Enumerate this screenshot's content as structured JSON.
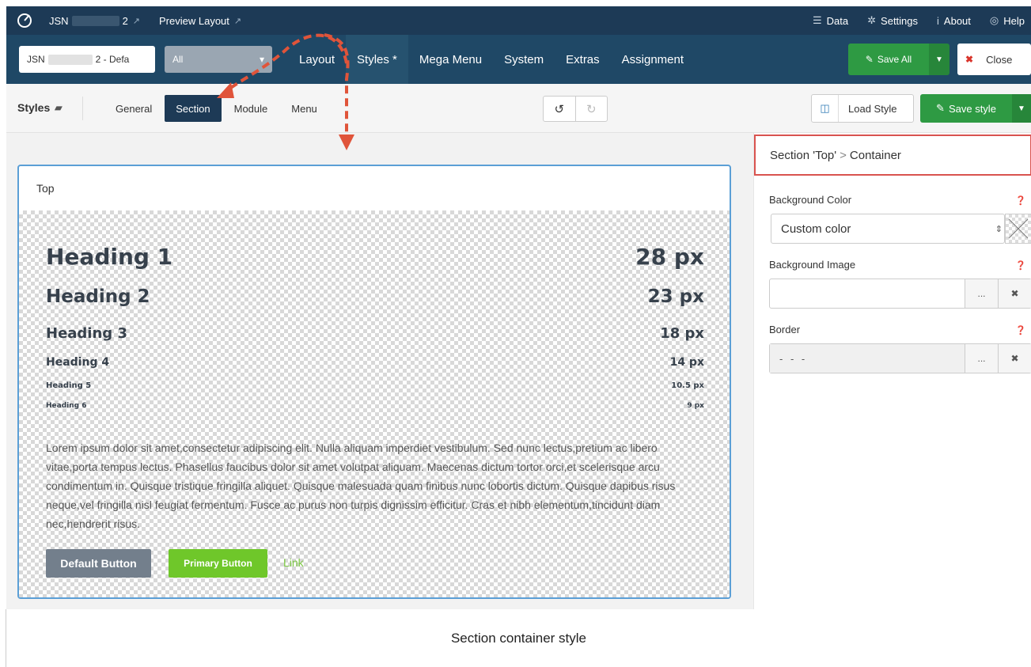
{
  "topbar": {
    "product_prefix": "JSN",
    "product_suffix": "2",
    "preview_layout": "Preview Layout",
    "data": "Data",
    "settings": "Settings",
    "about": "About",
    "help": "Help"
  },
  "navbar": {
    "layout_select_prefix": "JSN",
    "layout_select_suffix": "2 - Defa",
    "filter_select": "All",
    "tabs": [
      {
        "label": "Layout"
      },
      {
        "label": "Styles *"
      },
      {
        "label": "Mega Menu"
      },
      {
        "label": "System"
      },
      {
        "label": "Extras"
      },
      {
        "label": "Assignment"
      }
    ],
    "save_all": "Save All",
    "close": "Close"
  },
  "stylesbar": {
    "title": "Styles",
    "tabs": [
      {
        "label": "General"
      },
      {
        "label": "Section"
      },
      {
        "label": "Module"
      },
      {
        "label": "Menu"
      }
    ],
    "load_style": "Load Style",
    "save_style": "Save style"
  },
  "preview": {
    "section_name": "Top",
    "headings": [
      {
        "label": "Heading 1",
        "size": "28 px"
      },
      {
        "label": "Heading 2",
        "size": "23 px"
      },
      {
        "label": "Heading 3",
        "size": "18 px"
      },
      {
        "label": "Heading 4",
        "size": "14 px"
      },
      {
        "label": "Heading 5",
        "size": "10.5 px"
      },
      {
        "label": "Heading 6",
        "size": "9 px"
      }
    ],
    "paragraph": "Lorem ipsum dolor sit amet,consectetur adipiscing elit. Nulla aliquam imperdiet vestibulum. Sed nunc lectus,pretium ac libero vitae,porta tempus lectus. Phasellus faucibus dolor sit amet volutpat aliquam. Maecenas dictum tortor orci,et scelerisque arcu condimentum in. Quisque tristique fringilla aliquet. Quisque malesuada quam finibus nunc lobortis dictum. Quisque dapibus risus neque,vel fringilla nisl feugiat fermentum. Fusce ac purus non turpis dignissim efficitur. Cras et nibh elementum,tincidunt diam nec,hendrerit risus.",
    "default_button": "Default Button",
    "primary_button": "Primary Button",
    "link": "Link"
  },
  "panel": {
    "breadcrumb_section": "Section 'Top'",
    "breadcrumb_sep": ">",
    "breadcrumb_item": "Container",
    "background_color_label": "Background Color",
    "background_color_value": "Custom color",
    "background_image_label": "Background Image",
    "background_image_value": "",
    "border_label": "Border",
    "border_value": "- - -",
    "browse_label": "...",
    "clear_label": "✖"
  },
  "caption": "Section container style",
  "colors": {
    "topbar": "#1d3a56",
    "navbar": "#1f4866",
    "save_green": "#2e9a43",
    "primary_green": "#6fc72a",
    "default_gray": "#737f8c",
    "annotation_red": "#e0543a",
    "highlight_border": "#d9534f"
  },
  "icons": {
    "logo": "gear-logo-icon",
    "external": "external-link-icon",
    "data": "database-icon",
    "settings": "gear-icon",
    "about": "info-icon",
    "help": "lifebuoy-icon",
    "save": "edit-icon",
    "close": "close-icon",
    "undo": "undo-icon",
    "redo": "redo-icon",
    "load_style": "columns-icon"
  }
}
